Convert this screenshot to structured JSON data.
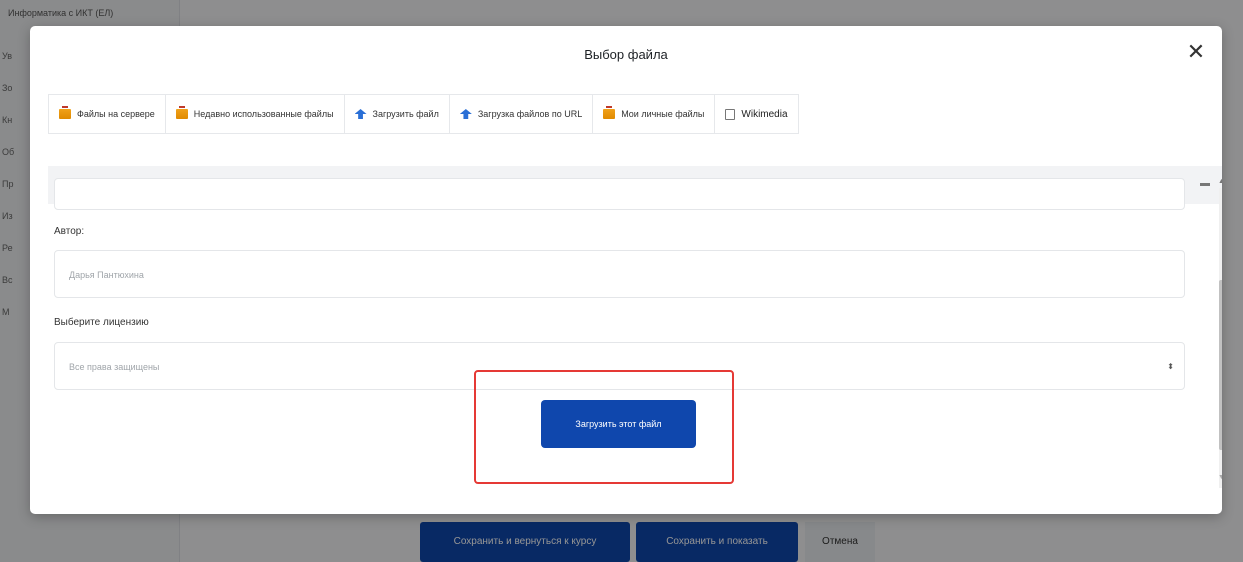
{
  "background": {
    "breadcrumb": "Информатика с ИКТ (ЕЛ)",
    "side_items": [
      "Ув",
      "Зо",
      "Кн",
      "Об",
      "Пр",
      "Из",
      "Ре",
      "Вс",
      "М"
    ],
    "buttons": [
      "Сохранить и вернуться к курсу",
      "Сохранить и показать",
      "Отмена"
    ]
  },
  "modal": {
    "title": "Выбор файла",
    "close_icon": "close-icon",
    "tabs": [
      {
        "label": "Файлы на сервере",
        "icon": "folder-icon"
      },
      {
        "label": "Недавно использованные файлы",
        "icon": "folder-icon"
      },
      {
        "label": "Загрузить файл",
        "icon": "upload-icon"
      },
      {
        "label": "Загрузка файлов по URL",
        "icon": "upload-icon"
      },
      {
        "label": "Мои личные файлы",
        "icon": "folder-icon"
      },
      {
        "label": "Wikimedia",
        "icon": "wikimedia-icon"
      }
    ],
    "view_icons": [
      "grid-view-icon",
      "list-view-icon",
      "tree-view-icon"
    ],
    "form": {
      "author_label": "Автор:",
      "author_value": "Дарья Пантюхина",
      "license_label": "Выберите лицензию",
      "license_value": "Все права защищены",
      "upload_button": "Загрузить этот файл"
    }
  },
  "colors": {
    "primary": "#0f47ad",
    "highlight": "#e53935"
  }
}
